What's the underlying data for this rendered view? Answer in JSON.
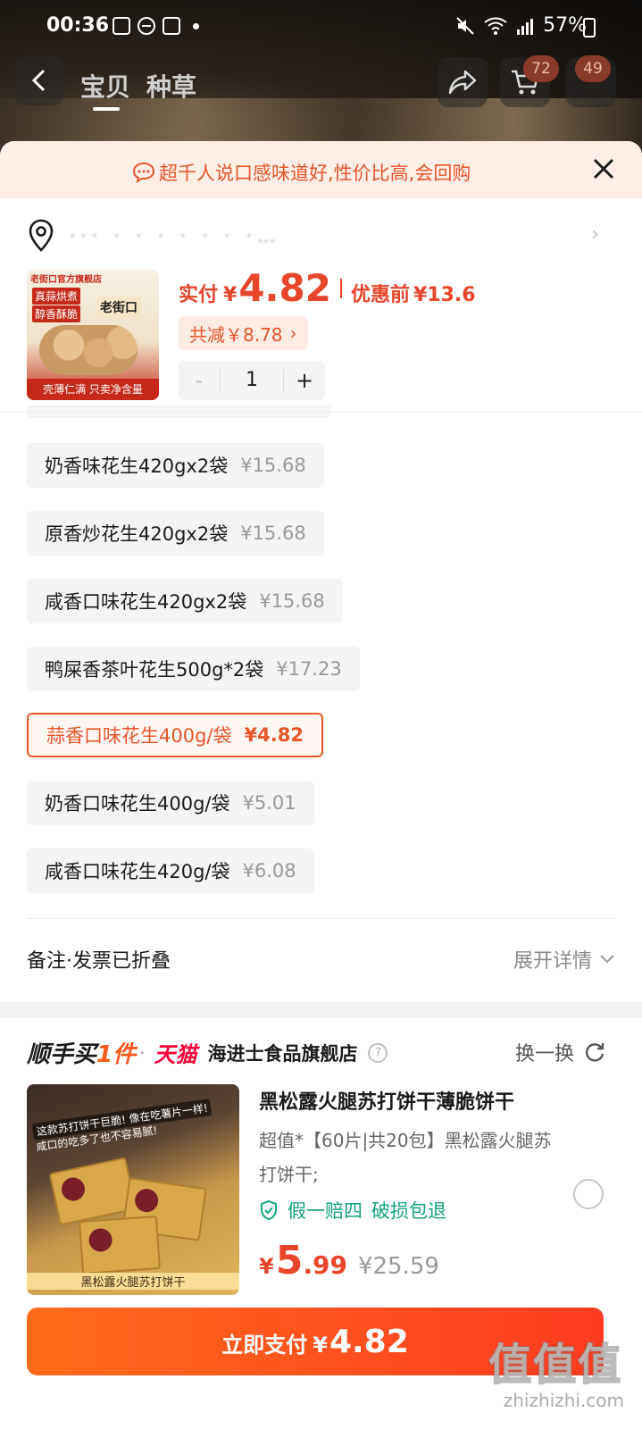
{
  "status_bar": {
    "time": "00:36",
    "battery": "57%"
  },
  "nav": {
    "tabs": [
      "宝贝",
      "种草"
    ],
    "cart_badge": "72",
    "more_badge": "49"
  },
  "tip": {
    "text": "超千人说口感味道好,性价比高,会回购"
  },
  "address": {
    "text": "··· ·  ·  ·   ·  ·  ·    ·…"
  },
  "product": {
    "thumb": {
      "store": "老街口官方旗舰店",
      "tag1": "真蒜烘煮",
      "tag2": "醇香酥脆",
      "brand": "老街口",
      "footer": "壳薄仁满 只卖净含量"
    },
    "price_label": "实付",
    "currency": "¥",
    "price": "4.82",
    "orig_label": "优惠前",
    "orig_price": "¥13.6",
    "discount": "共减￥8.78",
    "quantity": "1",
    "minus": "-",
    "plus": "+"
  },
  "options": [
    {
      "name": "奶香味花生420gx2袋",
      "price": "¥15.68"
    },
    {
      "name": "原香炒花生420gx2袋",
      "price": "¥15.68"
    },
    {
      "name": "咸香口味花生420gx2袋",
      "price": "¥15.68"
    },
    {
      "name": "鸭屎香茶叶花生500g*2袋",
      "price": "¥17.23"
    },
    {
      "name": "蒜香口味花生400g/袋",
      "price": "¥4.82",
      "selected": true
    },
    {
      "name": "奶香口味花生400g/袋",
      "price": "¥5.01"
    },
    {
      "name": "咸香口味花生420g/袋",
      "price": "¥6.08"
    }
  ],
  "remark": {
    "label": "备注·发票已折叠",
    "expand": "展开详情"
  },
  "recommend": {
    "title_prefix": "顺手买",
    "title_accent": "1件",
    "dot": "·",
    "platform": "天猫",
    "store": "海进士食品旗舰店",
    "help": "?",
    "swap": "换一换",
    "product": {
      "name": "黑松露火腿苏打饼干薄脆饼干",
      "desc": "超值*【60片|共20包】黑松露火腿苏打饼干;",
      "guarantee1": "假一赔四",
      "guarantee2": "破损包退",
      "currency": "¥",
      "price_int": "5",
      "price_dec": ".99",
      "old_price": "¥25.59",
      "img_banner1": "这款苏打饼干巨脆! 像在吃薯片一样!",
      "img_banner2": "咸口的吃多了也不容易腻!",
      "img_caption": "黑松露火腿苏打饼干"
    }
  },
  "pay": {
    "label": "立即支付",
    "currency": "¥",
    "amount": "4.82"
  },
  "watermark": {
    "main": "值值值",
    "sub": "zhizhizhi.com"
  },
  "colors": {
    "accent": "#e8462a",
    "selected_border": "#e8562a",
    "green": "#13a37e",
    "pay_button": "#ff4e1f"
  }
}
